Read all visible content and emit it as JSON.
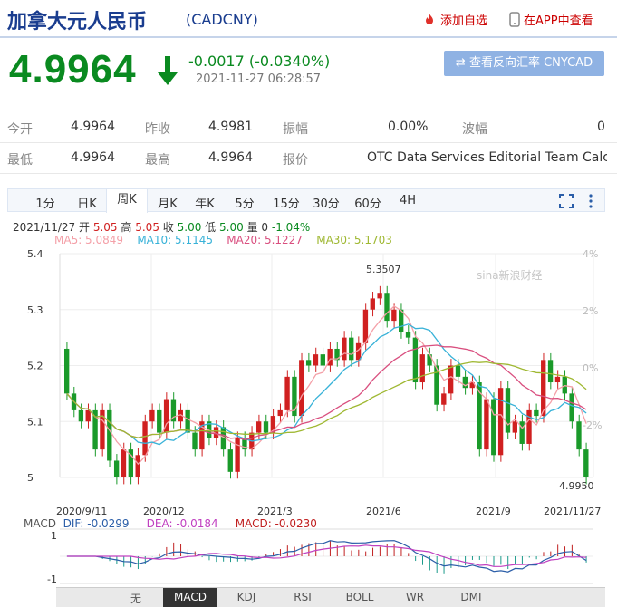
{
  "header": {
    "name": "加拿大元人民币",
    "code": "(CADCNY)",
    "add_fav": "添加自选",
    "app_view": "在APP中查看"
  },
  "quote": {
    "price": "4.9964",
    "change": "-0.0017 (-0.0340%)",
    "time": "2021-11-27 06:28:57",
    "reverse_button": "查看反向汇率 CNYCAD"
  },
  "stats": {
    "row1": [
      {
        "label": "今开",
        "value": "4.9964"
      },
      {
        "label": "昨收",
        "value": "4.9981"
      },
      {
        "label": "振幅",
        "value": "0.00%"
      },
      {
        "label": "波幅",
        "value": "0"
      }
    ],
    "row2": [
      {
        "label": "最低",
        "value": "4.9964"
      },
      {
        "label": "最高",
        "value": "4.9964"
      },
      {
        "label": "报价",
        "value": "OTC Data Services Editorial Team Calc..."
      }
    ]
  },
  "periods": [
    "1分",
    "日K",
    "周K",
    "月K",
    "年K",
    "5分",
    "15分",
    "30分",
    "60分",
    "4H"
  ],
  "selected_period": "周K",
  "ohlc_info": {
    "date": "2021/11/27",
    "open_label": "开",
    "open": "5.05",
    "high_label": "高",
    "high": "5.05",
    "close_label": "收",
    "close": "5.00",
    "low_label": "低",
    "low": "5.00",
    "vol_label": "量",
    "vol": "0",
    "pct": "-1.04%"
  },
  "ma_labels": [
    {
      "text": "MA5: 5.0849",
      "color": "#f4a0a8"
    },
    {
      "text": "MA10: 5.1145",
      "color": "#38b2d8"
    },
    {
      "text": "MA20: 5.1227",
      "color": "#d94f7f"
    },
    {
      "text": "MA30: 5.1703",
      "color": "#9fb832"
    }
  ],
  "watermark": "sina新浪财经",
  "chart_data": {
    "type": "candlestick",
    "ylim": [
      5.0,
      5.4
    ],
    "y_ticks": [
      "5.4",
      "5.3",
      "5.2",
      "5.1",
      "5"
    ],
    "right_ticks": [
      "4%",
      "2%",
      "0%",
      "-2%"
    ],
    "x_labels": [
      "2020/9/11",
      "2020/12",
      "2021/3",
      "2021/6",
      "2021/9",
      "2021/11/27"
    ],
    "high_annotation": "5.3507",
    "low_annotation": "4.9950",
    "candles": [
      [
        5.23,
        5.15
      ],
      [
        5.15,
        5.12
      ],
      [
        5.12,
        5.1
      ],
      [
        5.1,
        5.12
      ],
      [
        5.12,
        5.05
      ],
      [
        5.05,
        5.12
      ],
      [
        5.12,
        5.03
      ],
      [
        5.03,
        5.0
      ],
      [
        5.0,
        5.05
      ],
      [
        5.05,
        5.0
      ],
      [
        5.0,
        5.04
      ],
      [
        5.04,
        5.1
      ],
      [
        5.1,
        5.12
      ],
      [
        5.12,
        5.08
      ],
      [
        5.08,
        5.14
      ],
      [
        5.14,
        5.1
      ],
      [
        5.1,
        5.12
      ],
      [
        5.12,
        5.08
      ],
      [
        5.08,
        5.05
      ],
      [
        5.05,
        5.1
      ],
      [
        5.1,
        5.07
      ],
      [
        5.07,
        5.09
      ],
      [
        5.09,
        5.05
      ],
      [
        5.05,
        5.01
      ],
      [
        5.01,
        5.07
      ],
      [
        5.07,
        5.05
      ],
      [
        5.05,
        5.08
      ],
      [
        5.08,
        5.1
      ],
      [
        5.1,
        5.08
      ],
      [
        5.08,
        5.11
      ],
      [
        5.11,
        5.12
      ],
      [
        5.12,
        5.18
      ],
      [
        5.18,
        5.11
      ],
      [
        5.11,
        5.21
      ],
      [
        5.21,
        5.2
      ],
      [
        5.2,
        5.22
      ],
      [
        5.22,
        5.2
      ],
      [
        5.2,
        5.23
      ],
      [
        5.23,
        5.21
      ],
      [
        5.21,
        5.25
      ],
      [
        5.25,
        5.21
      ],
      [
        5.21,
        5.24
      ],
      [
        5.24,
        5.3
      ],
      [
        5.3,
        5.32
      ],
      [
        5.32,
        5.33
      ],
      [
        5.33,
        5.28
      ],
      [
        5.28,
        5.3
      ],
      [
        5.3,
        5.26
      ],
      [
        5.26,
        5.25
      ],
      [
        5.25,
        5.17
      ],
      [
        5.17,
        5.22
      ],
      [
        5.22,
        5.2
      ],
      [
        5.2,
        5.13
      ],
      [
        5.13,
        5.15
      ],
      [
        5.15,
        5.2
      ],
      [
        5.2,
        5.18
      ],
      [
        5.18,
        5.16
      ],
      [
        5.16,
        5.17
      ],
      [
        5.17,
        5.05
      ],
      [
        5.05,
        5.14
      ],
      [
        5.14,
        5.04
      ],
      [
        5.04,
        5.16
      ],
      [
        5.16,
        5.08
      ],
      [
        5.08,
        5.1
      ],
      [
        5.1,
        5.06
      ],
      [
        5.06,
        5.12
      ],
      [
        5.12,
        5.11
      ],
      [
        5.11,
        5.21
      ],
      [
        5.21,
        5.17
      ],
      [
        5.17,
        5.18
      ],
      [
        5.18,
        5.15
      ],
      [
        5.15,
        5.1
      ],
      [
        5.1,
        5.05
      ],
      [
        5.05,
        5.0
      ]
    ],
    "macd_label": "MACD",
    "dif": "DIF: -0.0299",
    "dea": "DEA: -0.0184",
    "macd": "MACD: -0.0230",
    "macd_ticks": [
      "1",
      "-1"
    ]
  },
  "indicators": [
    "无",
    "MACD",
    "KDJ",
    "RSI",
    "BOLL",
    "WR",
    "DMI"
  ],
  "selected_indicator": "MACD"
}
